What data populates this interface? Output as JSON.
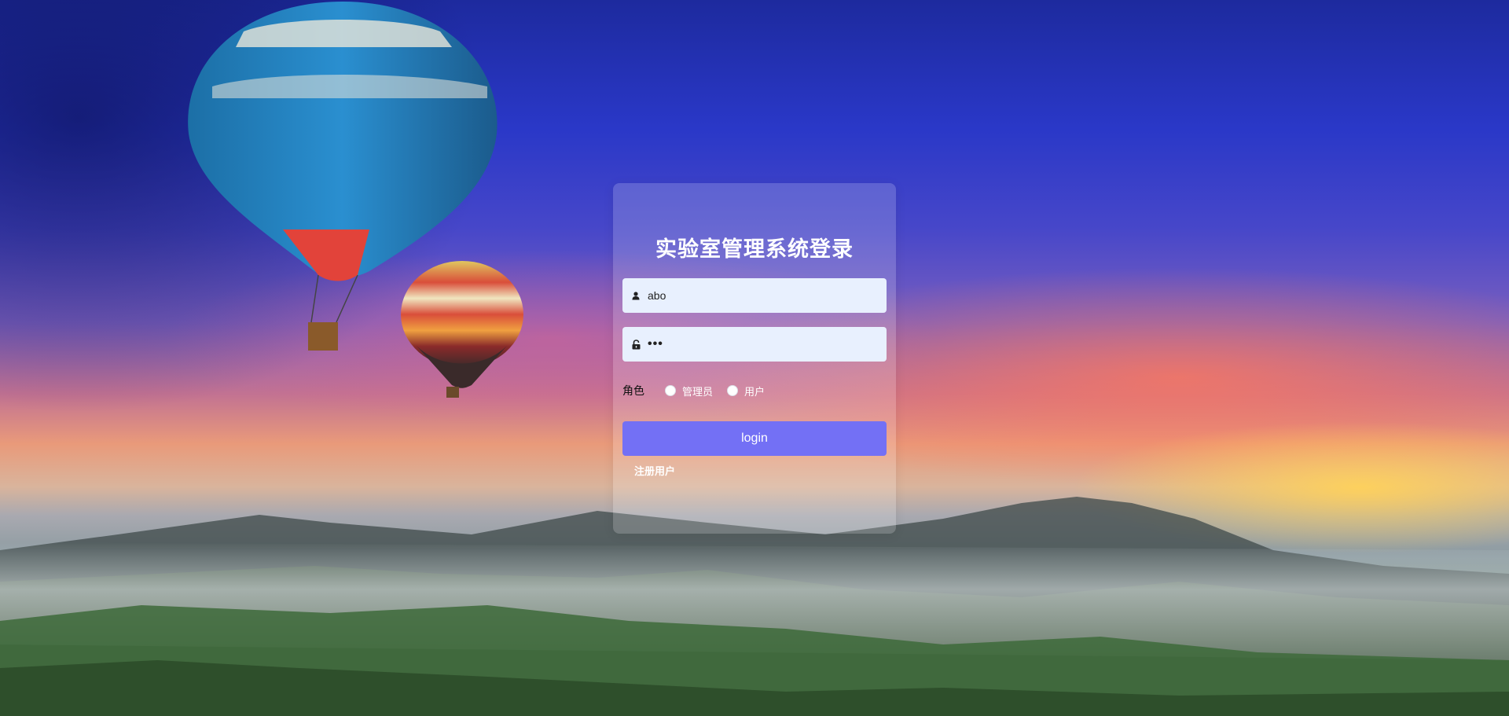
{
  "page": {
    "title": "实验室管理系统登录"
  },
  "form": {
    "username_value": "abo",
    "password_value": "•••",
    "role_label": "角色",
    "role_options": [
      "管理员",
      "用户"
    ],
    "login_label": "login",
    "register_link": "注册用户"
  },
  "icons": {
    "username": "user-icon",
    "password": "lock-icon"
  },
  "colors": {
    "login_button": "#7370f5",
    "input_background": "#e8f0fe",
    "card_background": "rgba(255,255,255,0.18)"
  }
}
